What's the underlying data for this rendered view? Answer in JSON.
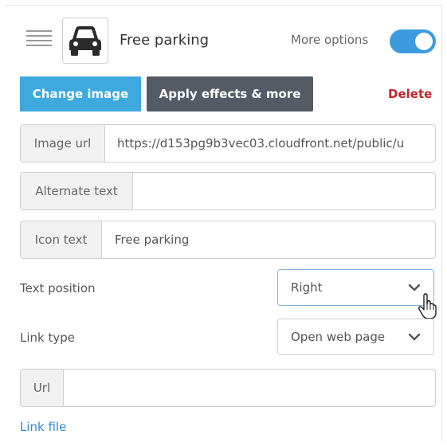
{
  "header": {
    "title": "Free parking",
    "more_options_label": "More options",
    "more_options_on": true,
    "thumbnail_icon": "car-icon"
  },
  "actions": {
    "change_image": "Change image",
    "apply_effects": "Apply effects & more",
    "delete": "Delete"
  },
  "fields": {
    "image_url": {
      "label": "Image url",
      "value": "https://d153pg9b3vec03.cloudfront.net/public/u"
    },
    "alternate_text": {
      "label": "Alternate text",
      "value": ""
    },
    "icon_text": {
      "label": "Icon text",
      "value": "Free parking"
    }
  },
  "text_position": {
    "label": "Text position",
    "selected": "Right"
  },
  "link_type": {
    "label": "Link type",
    "selected": "Open web page"
  },
  "url": {
    "label": "Url",
    "value": ""
  },
  "link_file": "Link file",
  "colors": {
    "primary": "#3ea9df",
    "dark_button": "#555b65",
    "delete": "#c1272d",
    "toggle": "#3b9bde",
    "link": "#2a8dd4"
  }
}
